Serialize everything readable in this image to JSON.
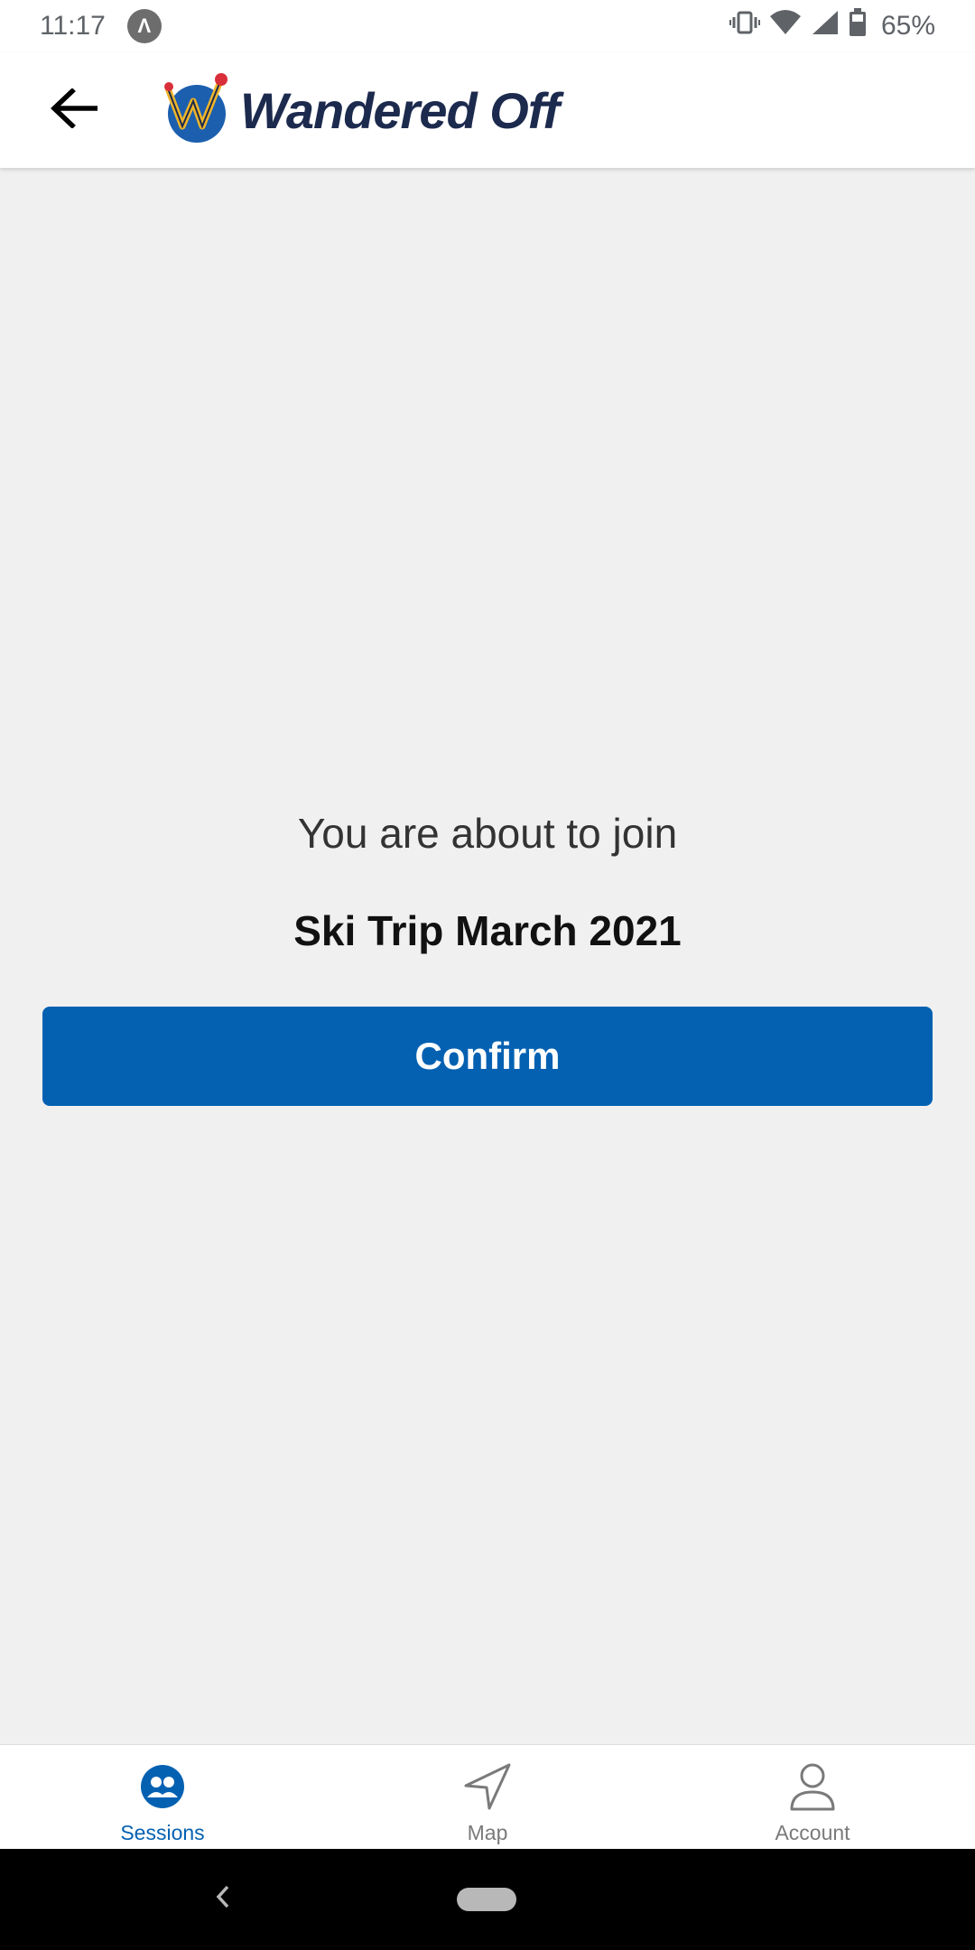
{
  "status_bar": {
    "time": "11:17",
    "app_badge": "Λ",
    "battery_percent": "65%",
    "icons": [
      "vibrate-icon",
      "wifi-icon",
      "signal-icon",
      "battery-icon"
    ]
  },
  "app_bar": {
    "back_icon": "arrow-left-icon",
    "logo_text": "Wandered Off"
  },
  "main": {
    "join_prompt": "You are about to join",
    "session_name": "Ski Trip March 2021",
    "confirm_label": "Confirm"
  },
  "tabs": [
    {
      "label": "Sessions",
      "icon": "sessions-icon",
      "active": true
    },
    {
      "label": "Map",
      "icon": "navigation-arrow-icon",
      "active": false
    },
    {
      "label": "Account",
      "icon": "person-icon",
      "active": false
    }
  ],
  "colors": {
    "accent": "#0461b2",
    "background": "#f0f0f0",
    "logo_text": "#1c2a4e",
    "inactive_tab": "#7a7a7a"
  }
}
